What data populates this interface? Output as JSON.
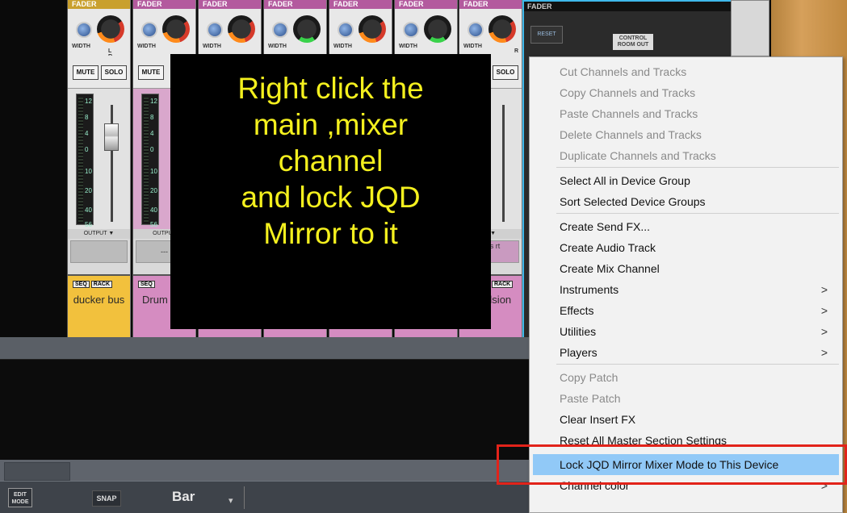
{
  "mixer": {
    "strips": [
      {
        "header": "FADER",
        "width_label": "WIDTH",
        "lr_label": "L R",
        "mute": "MUTE",
        "solo": "SOLO",
        "scale": [
          "12",
          "8",
          "4",
          "0",
          "10",
          "20",
          "40",
          "56"
        ],
        "output_label": "OUTPUT ▼",
        "output_value": "",
        "seq": "SEQ",
        "rack": "RACK",
        "name": "ducker bus",
        "color": "#f2c13d"
      },
      {
        "header": "FADER",
        "width_label": "WIDTH",
        "lr_label": "",
        "mute": "MUTE",
        "solo": "",
        "scale": [
          "12",
          "8",
          "4",
          "0",
          "10",
          "20",
          "40",
          "56"
        ],
        "output_label": "OUTPUT",
        "output_value": "---",
        "seq": "SEQ",
        "rack": "",
        "name": "Drum Sta",
        "color": "#d58cc1"
      },
      {
        "header": "FADER",
        "width_label": "WIDTH",
        "color": "#d58cc1"
      },
      {
        "header": "FADER",
        "width_label": "WIDTH",
        "color": "#d58cc1"
      },
      {
        "header": "FADER",
        "width_label": "WIDTH",
        "color": "#d58cc1"
      },
      {
        "header": "FADER",
        "width_label": "WIDTH",
        "color": "#d58cc1"
      },
      {
        "header": "FADER",
        "width_label": "WIDTH",
        "lr_label": "R",
        "solo": "SOLO",
        "output_label": "T ▼",
        "output_value": "Bus rt",
        "rack": "RACK",
        "name": "g in lsion",
        "color": "#d58cc1"
      }
    ],
    "main": {
      "header": "FADER",
      "reset": "RESET",
      "control_room": "CONTROL ROOM OUT"
    }
  },
  "overlay": {
    "lines": [
      "Right click the",
      "main ,mixer",
      "channel",
      "and lock JQD",
      "Mirror to it"
    ]
  },
  "toolbar": {
    "edit_mode": "EDIT MODE",
    "snap": "SNAP",
    "bar": "Bar",
    "caret": "▾"
  },
  "menu": {
    "items": [
      {
        "label": "Cut Channels and Tracks",
        "disabled": true
      },
      {
        "label": "Copy Channels and Tracks",
        "disabled": true
      },
      {
        "label": "Paste Channels and Tracks",
        "disabled": true
      },
      {
        "label": "Delete Channels and Tracks",
        "disabled": true
      },
      {
        "label": "Duplicate Channels and Tracks",
        "disabled": true
      },
      {
        "label": "Select All in Device Group",
        "disabled": false
      },
      {
        "label": "Sort Selected Device Groups",
        "disabled": false
      },
      {
        "label": "Create Send FX...",
        "disabled": false
      },
      {
        "label": "Create Audio Track",
        "disabled": false
      },
      {
        "label": "Create Mix Channel",
        "disabled": false
      },
      {
        "label": "Instruments",
        "disabled": false,
        "submenu": true
      },
      {
        "label": "Effects",
        "disabled": false,
        "submenu": true
      },
      {
        "label": "Utilities",
        "disabled": false,
        "submenu": true
      },
      {
        "label": "Players",
        "disabled": false,
        "submenu": true
      },
      {
        "label": "Copy Patch",
        "disabled": true
      },
      {
        "label": "Paste Patch",
        "disabled": true
      },
      {
        "label": "Clear Insert FX",
        "disabled": false
      },
      {
        "label": "Reset All Master Section Settings",
        "disabled": false
      },
      {
        "label": "Lock JQD Mirror Mixer Mode to This Device",
        "disabled": false,
        "highlighted": true
      },
      {
        "label": "Channel color",
        "disabled": false,
        "submenu": true
      }
    ],
    "arrow_glyph": ">"
  }
}
